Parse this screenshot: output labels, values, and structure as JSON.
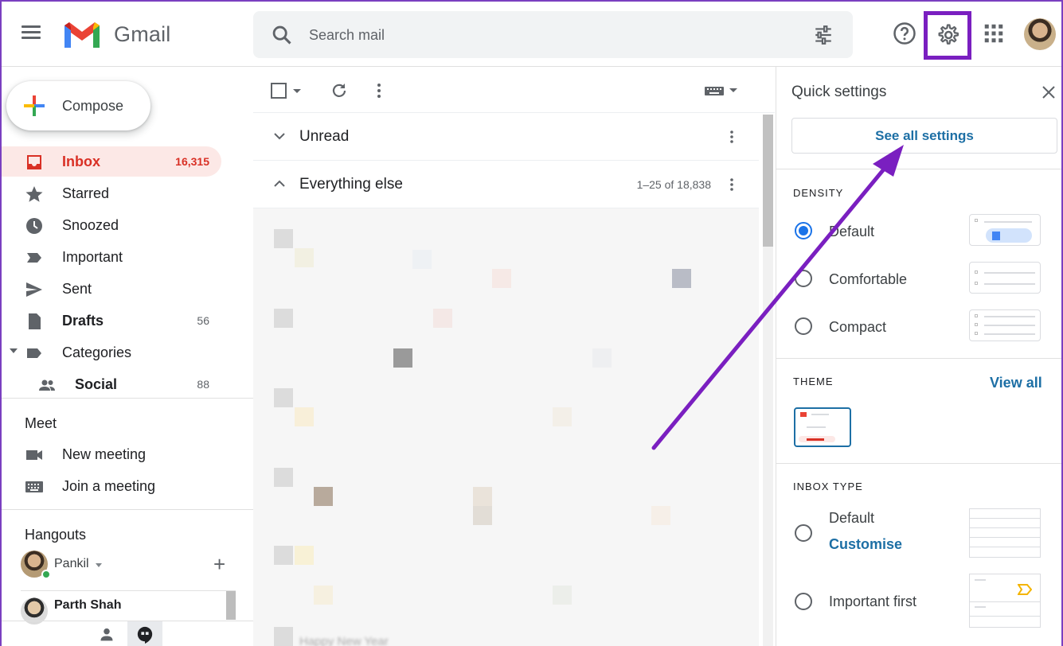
{
  "header": {
    "app_name": "Gmail",
    "search_placeholder": "Search mail"
  },
  "sidebar": {
    "compose_label": "Compose",
    "items": [
      {
        "label": "Inbox",
        "count": "16,315"
      },
      {
        "label": "Starred",
        "count": ""
      },
      {
        "label": "Snoozed",
        "count": ""
      },
      {
        "label": "Important",
        "count": ""
      },
      {
        "label": "Sent",
        "count": ""
      },
      {
        "label": "Drafts",
        "count": "56"
      },
      {
        "label": "Categories",
        "count": ""
      },
      {
        "label": "Social",
        "count": "88"
      }
    ],
    "meet": {
      "title": "Meet",
      "new_meeting": "New meeting",
      "join_meeting": "Join a meeting"
    },
    "hangouts": {
      "title": "Hangouts",
      "user": "Pankil",
      "contact": "Parth Shah"
    }
  },
  "main": {
    "sections": [
      {
        "title": "Unread",
        "range": ""
      },
      {
        "title": "Everything else",
        "range": "1–25 of 18,838"
      }
    ],
    "peek_text": "Happy New Year"
  },
  "quick_settings": {
    "title": "Quick settings",
    "see_all": "See all settings",
    "density": {
      "heading": "DENSITY",
      "options": [
        "Default",
        "Comfortable",
        "Compact"
      ],
      "selected": "Default"
    },
    "theme": {
      "heading": "THEME",
      "view_all": "View all"
    },
    "inbox_type": {
      "heading": "INBOX TYPE",
      "options": [
        "Default",
        "Important first"
      ],
      "customise": "Customise"
    }
  },
  "colors": {
    "accent_purple": "#7a1fc0",
    "inbox_red": "#d93025",
    "link_blue": "#1d6fa5"
  }
}
